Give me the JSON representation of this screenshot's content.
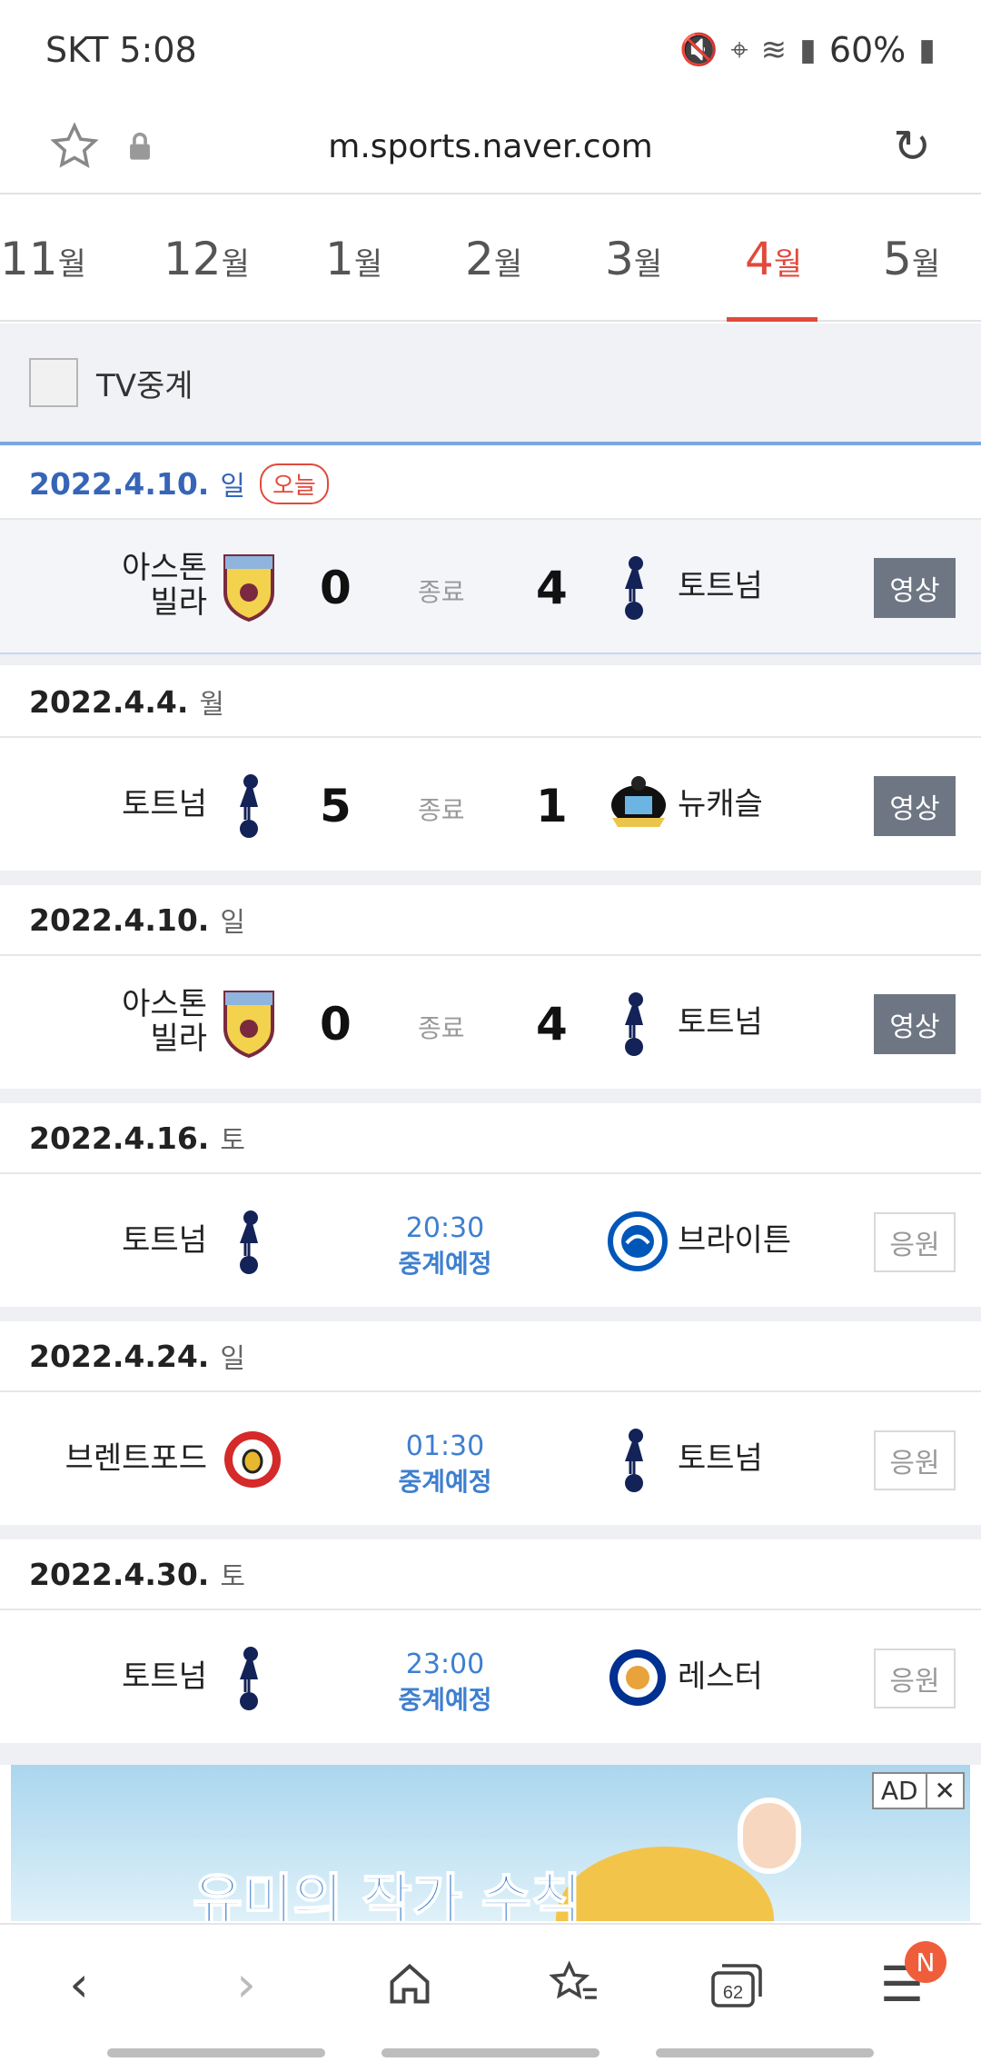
{
  "status_bar": {
    "carrier_time": "SKT 5:08",
    "battery": "60%"
  },
  "browser": {
    "url": "m.sports.naver.com",
    "tab_count": "62",
    "notification_badge": "N"
  },
  "months": [
    {
      "num": "11",
      "unit": "월"
    },
    {
      "num": "12",
      "unit": "월"
    },
    {
      "num": "1",
      "unit": "월"
    },
    {
      "num": "2",
      "unit": "월"
    },
    {
      "num": "3",
      "unit": "월"
    },
    {
      "num": "4",
      "unit": "월",
      "active": true
    },
    {
      "num": "5",
      "unit": "월"
    }
  ],
  "filter": {
    "tv_label": "TV중계"
  },
  "days": [
    {
      "date": "2022.4.10.",
      "weekday": "일",
      "badge": "오늘",
      "match": {
        "home": "아스톤\n빌라",
        "away": "토트넘",
        "home_score": "0",
        "away_score": "4",
        "status": "종료",
        "action": "영상"
      }
    },
    {
      "date": "2022.4.4.",
      "weekday": "월",
      "match": {
        "home": "토트넘",
        "away": "뉴캐슬",
        "home_score": "5",
        "away_score": "1",
        "status": "종료",
        "action": "영상"
      }
    },
    {
      "date": "2022.4.10.",
      "weekday": "일",
      "match": {
        "home": "아스톤\n빌라",
        "away": "토트넘",
        "home_score": "0",
        "away_score": "4",
        "status": "종료",
        "action": "영상"
      }
    },
    {
      "date": "2022.4.16.",
      "weekday": "토",
      "match": {
        "home": "토트넘",
        "away": "브라이튼",
        "time": "20:30",
        "schedule": "중계예정",
        "action": "응원"
      }
    },
    {
      "date": "2022.4.24.",
      "weekday": "일",
      "match": {
        "home": "브렌트포드",
        "away": "토트넘",
        "time": "01:30",
        "schedule": "중계예정",
        "action": "응원"
      }
    },
    {
      "date": "2022.4.30.",
      "weekday": "토",
      "match": {
        "home": "토트넘",
        "away": "레스터",
        "time": "23:00",
        "schedule": "중계예정",
        "action": "응원"
      }
    }
  ],
  "ad": {
    "badge": "AD",
    "close": "✕",
    "title": "유미의 작가 수칙"
  }
}
